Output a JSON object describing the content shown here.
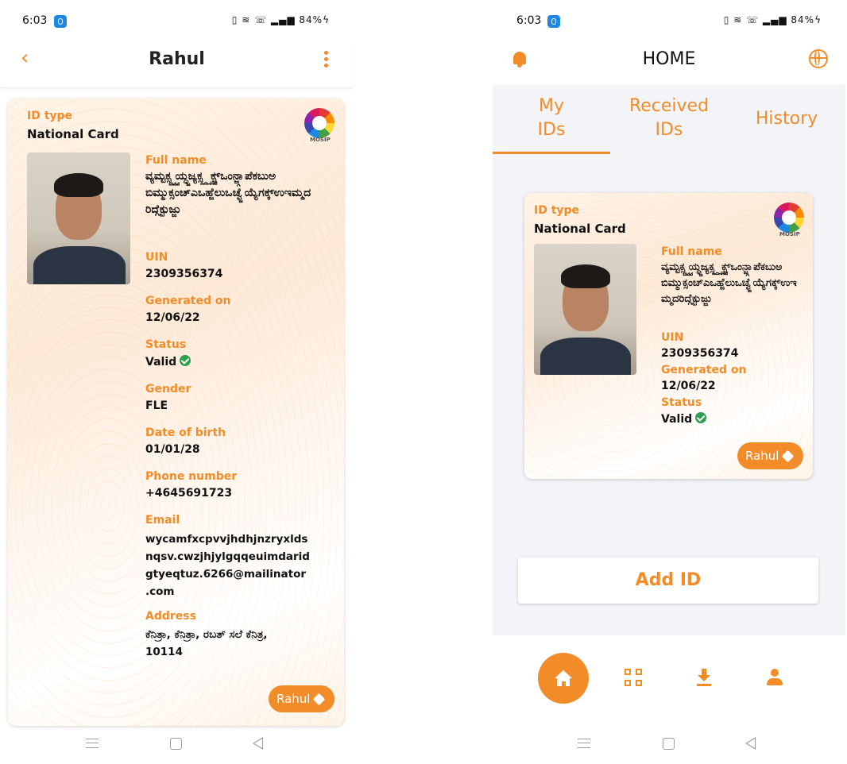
{
  "left": {
    "status": {
      "time": "6:03",
      "battery": "84%"
    },
    "header": {
      "title": "Rahul"
    },
    "card": {
      "id_type_label": "ID type",
      "id_type_value": "National Card",
      "logo_text": "MOSIP",
      "full_name_label": "Full name",
      "full_name_value": "ವ್ಯಮ್ಟಕ್ಸ್ಚ್ವ್ವಯ್ಧ್ಜಜ್ಯಕ್ಸ್ಲ್ದ್ಸ್ಸ್ವಕ್ಸ್ಒಂನ್ಜ್ಗಾಪೆಕಬುಅಬಿಮ್ಮುಕ್ಸಂಚ್ಎಒಹ್ಜೆಲುಒಚ್ವ್ಜೆಯ್ಯೆಗಕ್ಕ್ಉಇಮ್ಮದರಿದ್ಗೆಕ್ಟುಜ್ಜು",
      "uin_label": "UIN",
      "uin_value": "2309356374",
      "generated_label": "Generated on",
      "generated_value": "12/06/22",
      "status_label": "Status",
      "status_value": "Valid",
      "gender_label": "Gender",
      "gender_value": "FLE",
      "dob_label": "Date of birth",
      "dob_value": "01/01/28",
      "phone_label": "Phone number",
      "phone_value": "+4645691723",
      "email_label": "Email",
      "email_line1": "wycamfxcpvvjhdhjnzryxlds",
      "email_line2": "nqsv.cwzjhjylgqqeuimdarid",
      "email_line3": "gtyeqtuz.6266@mailinator",
      "email_line4": ".com",
      "address_label": "Address",
      "address_line1": "ಕೆನಿತ್ರಾ, ಕೆನಿತ್ರಾ, ರಬತ್ ಸಲೆ ಕೆನಿತ್ರ,",
      "address_line2": "10114",
      "tag_label": "Rahul"
    }
  },
  "right": {
    "status": {
      "time": "6:03",
      "battery": "84%"
    },
    "header": {
      "title": "HOME"
    },
    "tabs": [
      {
        "line1": "My",
        "line2": "IDs"
      },
      {
        "line1": "Received",
        "line2": "IDs"
      },
      {
        "line1": "History",
        "line2": ""
      }
    ],
    "card": {
      "id_type_label": "ID type",
      "id_type_value": "National Card",
      "logo_text": "MOSIP",
      "full_name_label": "Full name",
      "full_name_value": "ವ್ಯಮ್ಟಕ್ಸ್ಚ್ವ್ವಯ್ಧ್ಜಜ್ಯಕ್ಸ್ಲ್ದ್ಸ್ಸ್ವಕ್ಸ್ಒಂನ್ಜ್ಗಾಪೆಕಬುಅಬಿಮ್ಮುಕ್ಸಂಚ್ಎಒಹ್ಜೆಲುಒಚ್ವ್ಜೆಯ್ಯೆಗಕ್ಕ್ಉಇಮ್ಮದರಿದ್ಗೆಕ್ಟುಜ್ಜು",
      "uin_label": "UIN",
      "uin_value": "2309356374",
      "generated_label": "Generated on",
      "generated_value": "12/06/22",
      "status_label": "Status",
      "status_value": "Valid",
      "tag_label": "Rahul"
    },
    "add_id_label": "Add ID"
  },
  "colors": {
    "accent": "#f28c28",
    "valid": "#2e9e4f"
  }
}
